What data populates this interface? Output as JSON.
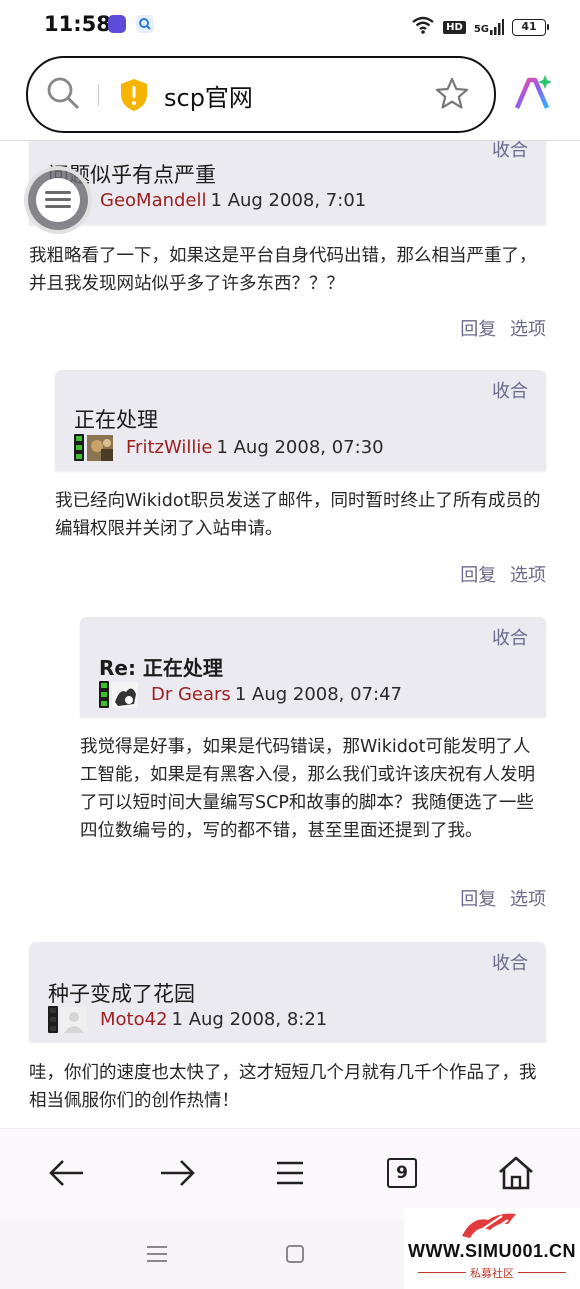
{
  "status_bar": {
    "time": "11:58",
    "hd": "HD",
    "signal": "5G",
    "battery": "41"
  },
  "address_bar": {
    "url_text": "scp官网"
  },
  "posts": [
    {
      "collapse": "收合",
      "title": "问题似乎有点严重",
      "author": "GeoMandell",
      "date": "1 Aug 2008, 7:01",
      "body": "我粗略看了一下，如果这是平台自身代码出错，那么相当严重了，并且我发现网站似乎多了许多东西？？？",
      "reply": "回复",
      "options": "选项"
    },
    {
      "collapse": "收合",
      "title": "正在处理",
      "author": "FritzWillie",
      "date": "1 Aug 2008, 07:30",
      "body": "我已经向Wikidot职员发送了邮件，同时暂时终止了所有成员的编辑权限并关闭了入站申请。",
      "reply": "回复",
      "options": "选项"
    },
    {
      "collapse": "收合",
      "title": "Re: 正在处理",
      "author": "Dr Gears",
      "date": "1 Aug 2008, 07:47",
      "body": "我觉得是好事，如果是代码错误，那Wikidot可能发明了人工智能，如果是有黑客入侵，那么我们或许该庆祝有人发明了可以短时间大量编写SCP和故事的脚本？我随便选了一些四位数编号的，写的都不错，甚至里面还提到了我。",
      "reply": "回复",
      "options": "选项"
    },
    {
      "collapse": "收合",
      "title": "种子变成了花园",
      "author": "Moto42",
      "date": "1 Aug 2008, 8:21",
      "body": "哇，你们的速度也太快了，这才短短几个月就有几千个作品了，我相当佩服你们的创作热情！"
    }
  ],
  "toolbar": {
    "tab_count": "9"
  },
  "watermark": {
    "text": "WWW.SIMU001.CN",
    "sub": "私募社区"
  },
  "colors": {
    "post_bg": "#ebeaf0",
    "author": "#9c1f1f",
    "link": "#6a6a8c",
    "karma_on": "#3fbf2e"
  }
}
